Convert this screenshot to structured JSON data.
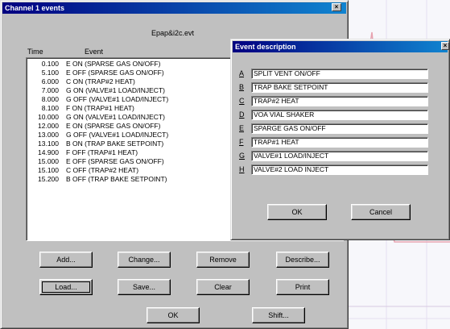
{
  "channel_window": {
    "title": "Channel 1 events",
    "filename": "Epap&i2c.evt",
    "col_time": "Time",
    "col_event": "Event",
    "events": [
      {
        "time": "0.100",
        "event": "E ON (SPARSE GAS ON/OFF)"
      },
      {
        "time": "5.100",
        "event": "E OFF (SPARSE GAS ON/OFF)"
      },
      {
        "time": "6.000",
        "event": "C ON (TRAP#2 HEAT)"
      },
      {
        "time": "7.000",
        "event": "G ON (VALVE#1  LOAD/INJECT)"
      },
      {
        "time": "8.000",
        "event": "G OFF (VALVE#1  LOAD/INJECT)"
      },
      {
        "time": "8.100",
        "event": "F ON (TRAP#1 HEAT)"
      },
      {
        "time": "10.000",
        "event": "G ON (VALVE#1  LOAD/INJECT)"
      },
      {
        "time": "12.000",
        "event": "E ON (SPARSE GAS ON/OFF)"
      },
      {
        "time": "13.000",
        "event": "G OFF (VALVE#1  LOAD/INJECT)"
      },
      {
        "time": "13.100",
        "event": "B ON (TRAP BAKE SETPOINT)"
      },
      {
        "time": "14.900",
        "event": "F OFF (TRAP#1 HEAT)"
      },
      {
        "time": "15.000",
        "event": "E OFF (SPARSE GAS ON/OFF)"
      },
      {
        "time": "15.100",
        "event": "C OFF (TRAP#2 HEAT)"
      },
      {
        "time": "15.200",
        "event": "B OFF (TRAP BAKE SETPOINT)"
      }
    ],
    "buttons": {
      "add": "Add...",
      "change": "Change...",
      "remove": "Remove",
      "describe": "Describe...",
      "load": "Load...",
      "save": "Save...",
      "clear": "Clear",
      "print": "Print",
      "ok": "OK",
      "shift": "Shift..."
    }
  },
  "desc_window": {
    "title": "Event description",
    "items": [
      {
        "key": "A",
        "value": "SPLIT VENT ON/OFF"
      },
      {
        "key": "B",
        "value": "TRAP BAKE SETPOINT"
      },
      {
        "key": "C",
        "value": "TRAP#2 HEAT"
      },
      {
        "key": "D",
        "value": "VOA VIAL SHAKER"
      },
      {
        "key": "E",
        "value": "SPARGE GAS ON/OFF"
      },
      {
        "key": "F",
        "value": "TRAP#1 HEAT"
      },
      {
        "key": "G",
        "value": "VALVE#1  LOAD/INJECT"
      },
      {
        "key": "H",
        "value": "VALVE#2 LOAD INJECT"
      }
    ],
    "ok": "OK",
    "cancel": "Cancel"
  },
  "colors": {
    "titlebar": "#000080",
    "face": "#c0c0c0",
    "backdrop_trace": "#e7a3b0"
  }
}
